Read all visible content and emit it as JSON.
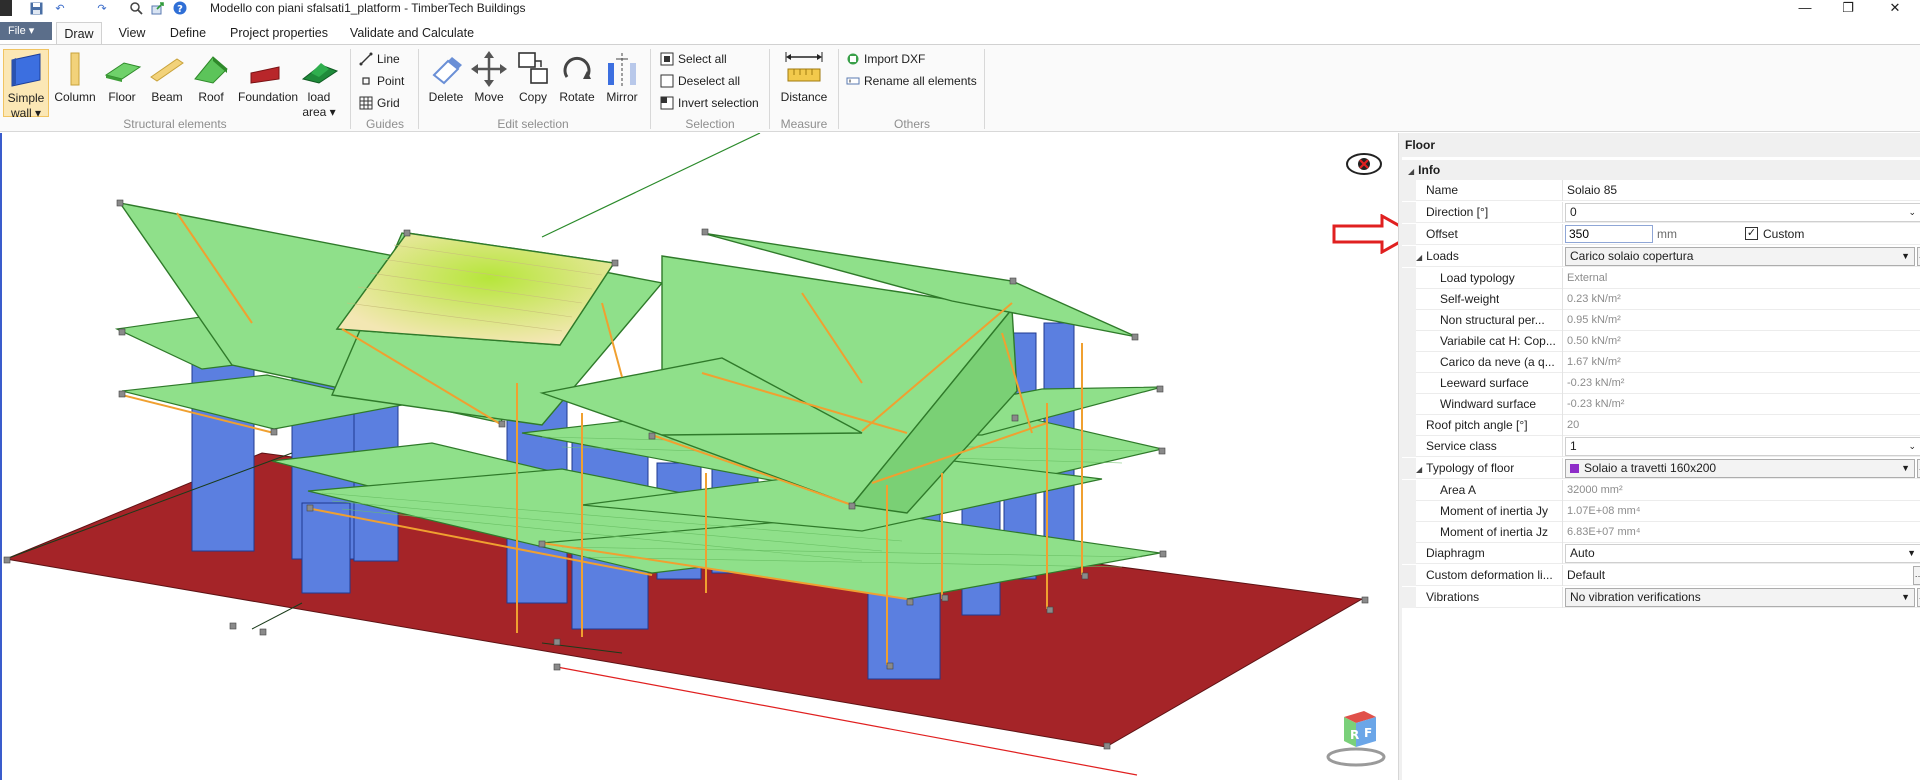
{
  "window": {
    "title": "Modello con piani sfalsati1_platform - TimberTech Buildings",
    "controls": {
      "minimize": "—",
      "maximize": "❐",
      "close": "✕"
    }
  },
  "quick_access": {
    "icons": [
      "app-icon",
      "save-icon",
      "undo-icon",
      "redo-icon",
      "search-icon",
      "export-icon",
      "help-icon"
    ]
  },
  "tabs": {
    "file": "File ▾",
    "items": [
      "Draw",
      "View",
      "Define",
      "Project properties",
      "Validate and Calculate"
    ],
    "active": "Draw"
  },
  "ribbon": {
    "structural": {
      "group_label": "Structural elements",
      "buttons": [
        {
          "label": "Simple\nwall ▾",
          "line1": "Simple",
          "line2": "wall ▾",
          "icon": "wall-icon"
        },
        {
          "label": "Column",
          "icon": "column-icon"
        },
        {
          "label": "Floor",
          "icon": "floor-icon"
        },
        {
          "label": "Beam",
          "icon": "beam-icon"
        },
        {
          "label": "Roof",
          "icon": "roof-icon"
        },
        {
          "label": "Foundation",
          "icon": "foundation-icon"
        },
        {
          "line1": "load",
          "line2": "area ▾",
          "icon": "load-area-icon"
        }
      ]
    },
    "guides": {
      "group_label": "Guides",
      "items": [
        "Line",
        "Point",
        "Grid"
      ]
    },
    "edit": {
      "group_label": "Edit selection",
      "buttons": [
        "Delete",
        "Move",
        "Copy",
        "Rotate",
        "Mirror"
      ]
    },
    "selection": {
      "group_label": "Selection",
      "items": [
        "Select all",
        "Deselect all",
        "Invert selection"
      ]
    },
    "measure": {
      "group_label": "Measure",
      "button": "Distance"
    },
    "others": {
      "group_label": "Others",
      "items": [
        "Import DXF",
        "Rename all elements"
      ]
    }
  },
  "viewport": {
    "icons": [
      "visibility-toggle-icon",
      "view-cube-icon"
    ],
    "view_cube_letters": {
      "a": "R",
      "b": "F"
    },
    "colors": {
      "floor": "#8fe08a",
      "wall": "#5b7fe0",
      "ground": "#a52428",
      "beam": "#f0a030",
      "selected": "#d9ef7a"
    }
  },
  "annotation": {
    "arrow_color": "#e02020"
  },
  "properties": {
    "title": "Floor",
    "info_label": "Info",
    "rows": {
      "name": {
        "label": "Name",
        "value": "Solaio 85"
      },
      "direction": {
        "label": "Direction [°]",
        "value": "0"
      },
      "offset": {
        "label": "Offset",
        "value": "350",
        "unit": "mm",
        "custom_label": "Custom",
        "custom_checked": true
      },
      "loads": {
        "label": "Loads",
        "value": "Carico solaio copertura"
      },
      "load_typology": {
        "label": "Load typology",
        "value": "External"
      },
      "self_weight": {
        "label": "Self-weight",
        "value": "0.23 kN/m²"
      },
      "non_structural": {
        "label": "Non structural per...",
        "value": "0.95 kN/m²"
      },
      "variabile": {
        "label": "Variabile cat H: Cop...",
        "value": "0.50 kN/m²"
      },
      "neve": {
        "label": "Carico da neve (a q...",
        "value": "1.67 kN/m²"
      },
      "leeward": {
        "label": "Leeward surface",
        "value": "-0.23 kN/m²"
      },
      "windward": {
        "label": "Windward surface",
        "value": "-0.23 kN/m²"
      },
      "roof_pitch": {
        "label": "Roof pitch angle [°]",
        "value": "20"
      },
      "service_class": {
        "label": "Service class",
        "value": "1"
      },
      "typology": {
        "label": "Typology of floor",
        "value": "Solaio a travetti 160x200",
        "swatch": "#8e2cc8"
      },
      "area": {
        "label": "Area A",
        "value": "32000 mm²"
      },
      "inertia_jy": {
        "label": "Moment of inertia Jy",
        "value": "1.07E+08 mm⁴"
      },
      "inertia_jz": {
        "label": "Moment of inertia Jz",
        "value": "6.83E+07 mm⁴"
      },
      "diaphragm": {
        "label": "Diaphragm",
        "value": "Auto"
      },
      "custom_def": {
        "label": "Custom deformation li...",
        "value": "Default"
      },
      "vibrations": {
        "label": "Vibrations",
        "value": "No vibration verifications"
      }
    }
  }
}
